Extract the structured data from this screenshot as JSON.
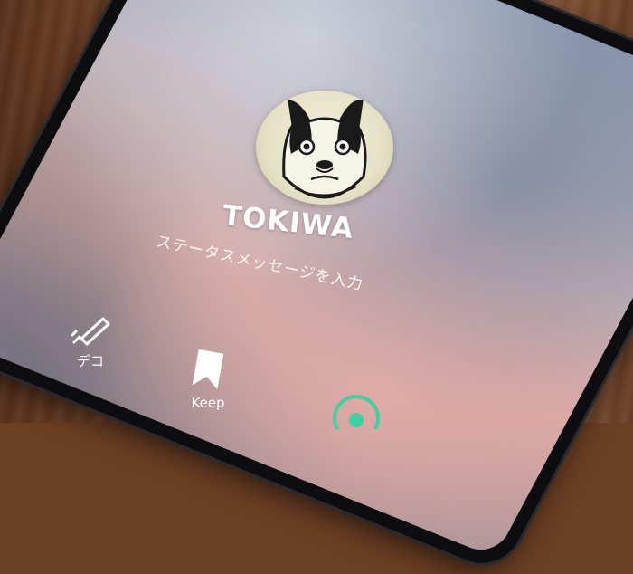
{
  "profile": {
    "name": "TOKIWA",
    "status_placeholder": "ステータスメッセージを入力"
  },
  "actions": [
    {
      "label": "デコ",
      "icon": "pen-decorate-icon"
    },
    {
      "label": "Keep",
      "icon": "bookmark-icon"
    },
    {
      "label": "",
      "icon": "camera-icon"
    }
  ],
  "colors": {
    "text": "#ffffff",
    "third_icon_accent": "#3fd0a0"
  }
}
